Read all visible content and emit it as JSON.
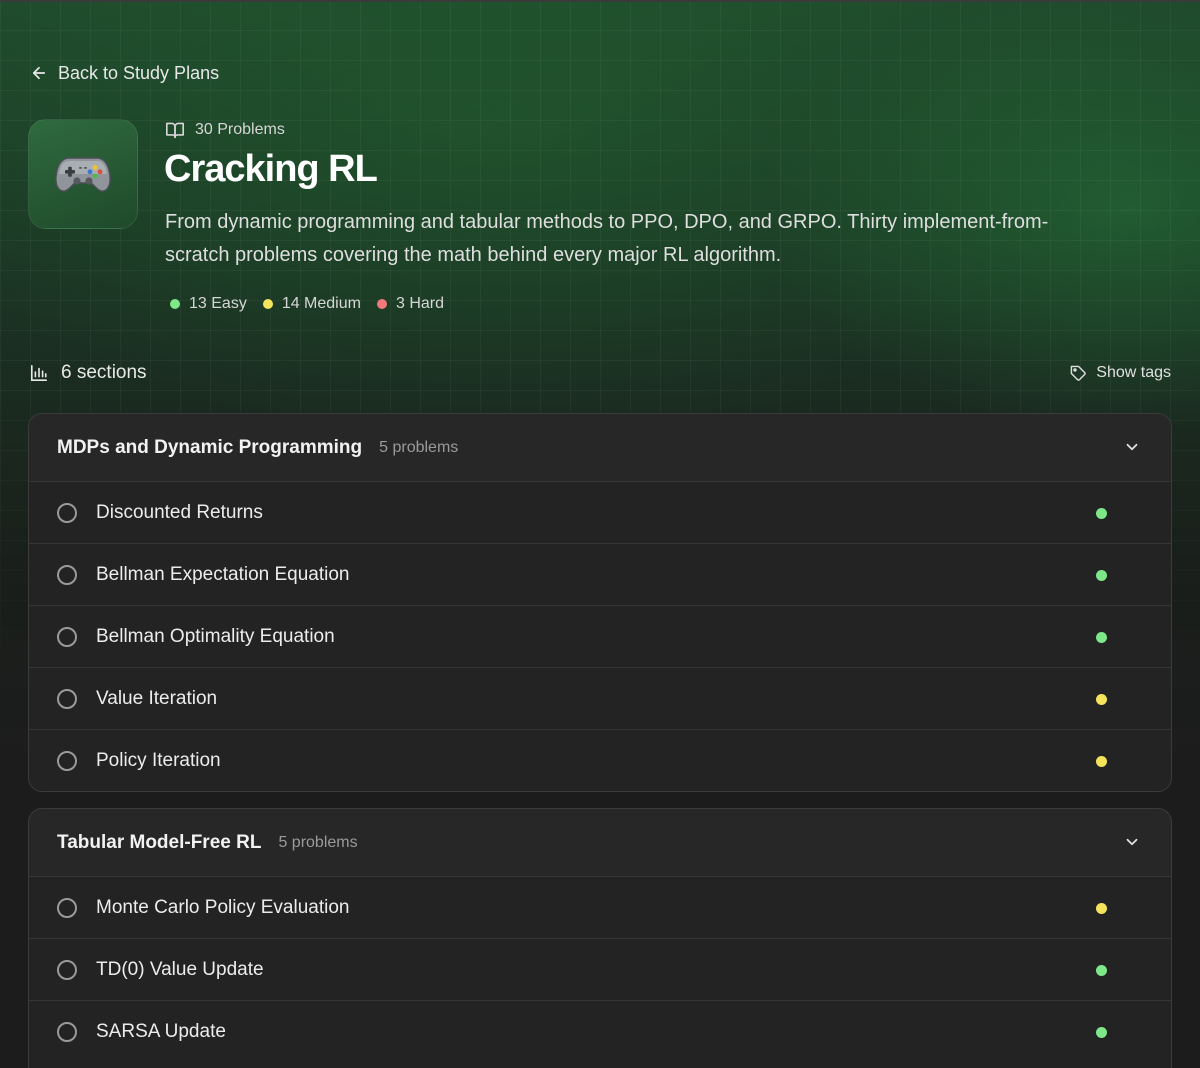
{
  "back_link": {
    "label": "Back to Study Plans"
  },
  "plan": {
    "problem_count": "30 Problems",
    "title": "Cracking RL",
    "description": "From dynamic programming and tabular methods to PPO, DPO, and GRPO. Thirty implement-from-scratch problems covering the math behind every major RL algorithm.",
    "icon": "game-controller-icon"
  },
  "difficulty": {
    "easy": "13 Easy",
    "medium": "14 Medium",
    "hard": "3 Hard"
  },
  "colors": {
    "easy": "#7ee787",
    "medium": "#f5e35c",
    "hard": "#f07a7a"
  },
  "sections_count": "6 sections",
  "show_tags": "Show tags",
  "sections": [
    {
      "title": "MDPs and Dynamic Programming",
      "count": "5 problems",
      "problems": [
        {
          "name": "Discounted Returns",
          "difficulty": "easy"
        },
        {
          "name": "Bellman Expectation Equation",
          "difficulty": "easy"
        },
        {
          "name": "Bellman Optimality Equation",
          "difficulty": "easy"
        },
        {
          "name": "Value Iteration",
          "difficulty": "medium"
        },
        {
          "name": "Policy Iteration",
          "difficulty": "medium"
        }
      ]
    },
    {
      "title": "Tabular Model-Free RL",
      "count": "5 problems",
      "problems": [
        {
          "name": "Monte Carlo Policy Evaluation",
          "difficulty": "medium"
        },
        {
          "name": "TD(0) Value Update",
          "difficulty": "easy"
        },
        {
          "name": "SARSA Update",
          "difficulty": "easy"
        }
      ]
    }
  ]
}
